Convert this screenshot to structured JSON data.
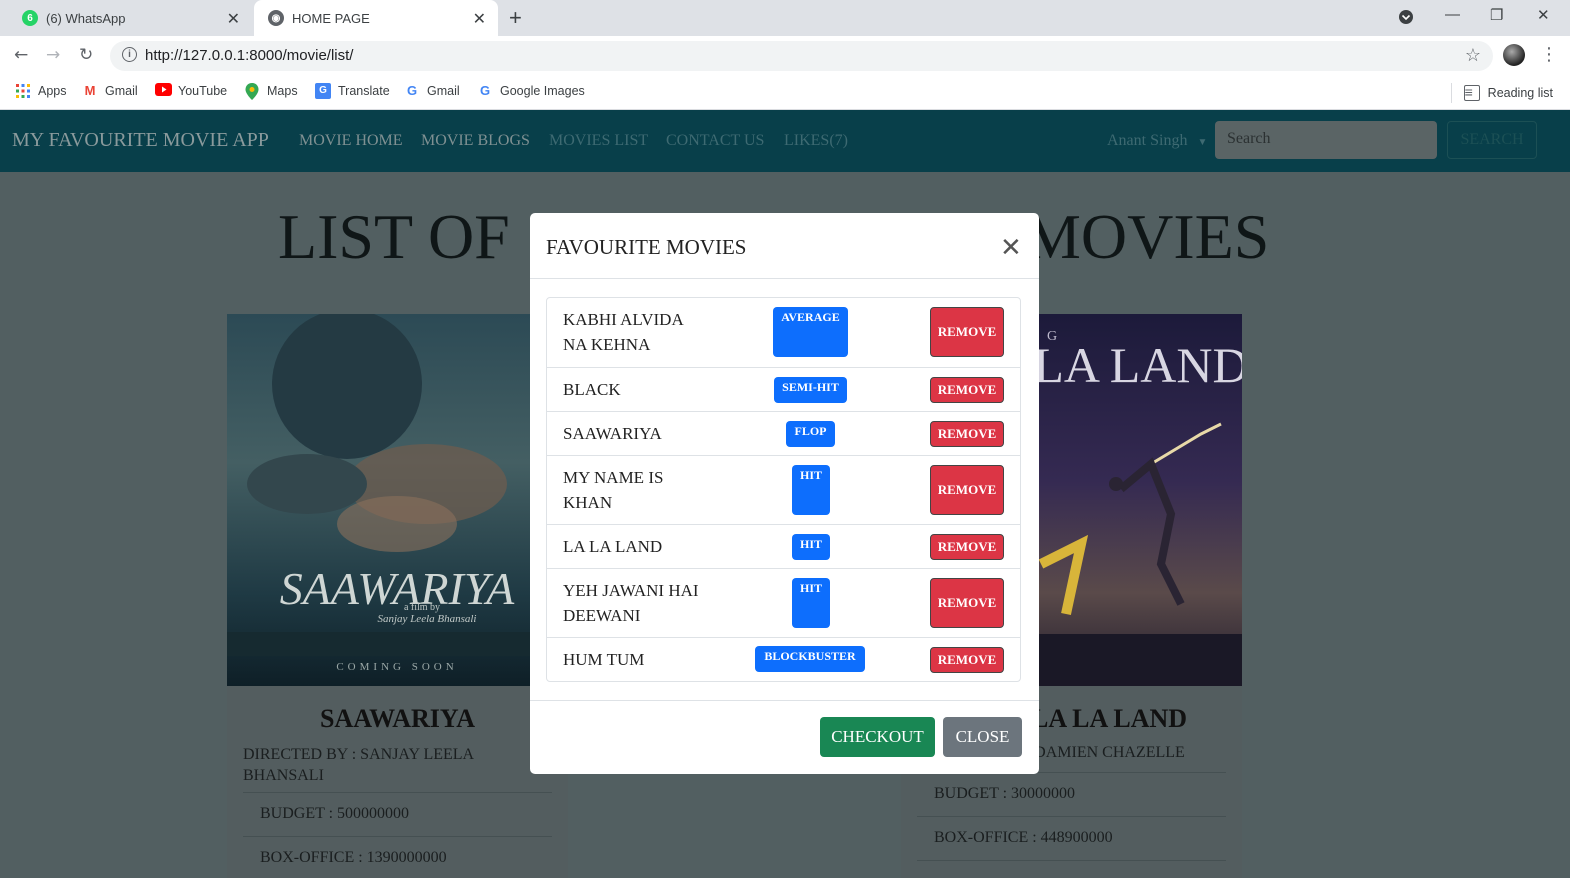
{
  "browser": {
    "tabs": [
      {
        "label": "(6) WhatsApp",
        "badge": "6"
      },
      {
        "label": "HOME PAGE"
      }
    ],
    "new_tab": "+",
    "url": "http://127.0.0.1:8000/movie/list/",
    "bookmarks": [
      {
        "label": "Apps",
        "icon": "apps-grid-icon"
      },
      {
        "label": "Gmail",
        "icon": "gmail-icon"
      },
      {
        "label": "YouTube",
        "icon": "youtube-icon"
      },
      {
        "label": "Maps",
        "icon": "maps-pin-icon"
      },
      {
        "label": "Translate",
        "icon": "translate-icon"
      },
      {
        "label": "Gmail",
        "icon": "google-g-icon"
      },
      {
        "label": "Google Images",
        "icon": "google-g-icon"
      }
    ],
    "reading_list": "Reading list"
  },
  "navbar": {
    "brand": "MY FAVOURITE MOVIE APP",
    "links": [
      "MOVIE HOME",
      "MOVIE BLOGS",
      "MOVIES LIST",
      "CONTACT US",
      "LIKES(7)"
    ],
    "user": "Anant Singh",
    "search_placeholder": "Search",
    "search_button": "SEARCH"
  },
  "page": {
    "title_left": "LIST OF",
    "title_right": "MOVIES"
  },
  "cards": [
    {
      "title": "SAAWARIYA",
      "director": "DIRECTED BY : SANJAY LEELA BHANSALI",
      "budget": "BUDGET : 500000000",
      "box_office": "BOX-OFFICE : 1390000000",
      "poster_text": "SAAWARIYA",
      "poster_subtext": "a film by",
      "poster_director": "Sanjay Leela Bhansali",
      "poster_footer": "COMING SOON"
    },
    {
      "title": "LA LA LAND",
      "director": "DIRECTED BY : DAMIEN CHAZELLE",
      "budget": "BUDGET : 30000000",
      "box_office": "BOX-OFFICE : 448900000",
      "poster_text": "LA LAND",
      "poster_letter": "G"
    }
  ],
  "modal": {
    "title": "FAVOURITE MOVIES",
    "items": [
      {
        "name": "KABHI ALVIDA NA KEHNA",
        "verdict": "AVERAGE",
        "action": "REMOVE"
      },
      {
        "name": "BLACK",
        "verdict": "SEMI-HIT",
        "action": "REMOVE"
      },
      {
        "name": "SAAWARIYA",
        "verdict": "FLOP",
        "action": "REMOVE"
      },
      {
        "name": "MY NAME IS KHAN",
        "verdict": "HIT",
        "action": "REMOVE"
      },
      {
        "name": "LA LA LAND",
        "verdict": "HIT",
        "action": "REMOVE"
      },
      {
        "name": "YEH JAWANI HAI DEEWANI",
        "verdict": "HIT",
        "action": "REMOVE"
      },
      {
        "name": "HUM TUM",
        "verdict": "BLOCKBUSTER",
        "action": "REMOVE"
      }
    ],
    "checkout": "CHECKOUT",
    "close": "CLOSE"
  },
  "colors": {
    "navbar": "#083f4a",
    "overlay": "#525f61",
    "badge": "#0d6efd",
    "remove": "#dc3545",
    "checkout": "#198754",
    "close": "#6c757d"
  }
}
